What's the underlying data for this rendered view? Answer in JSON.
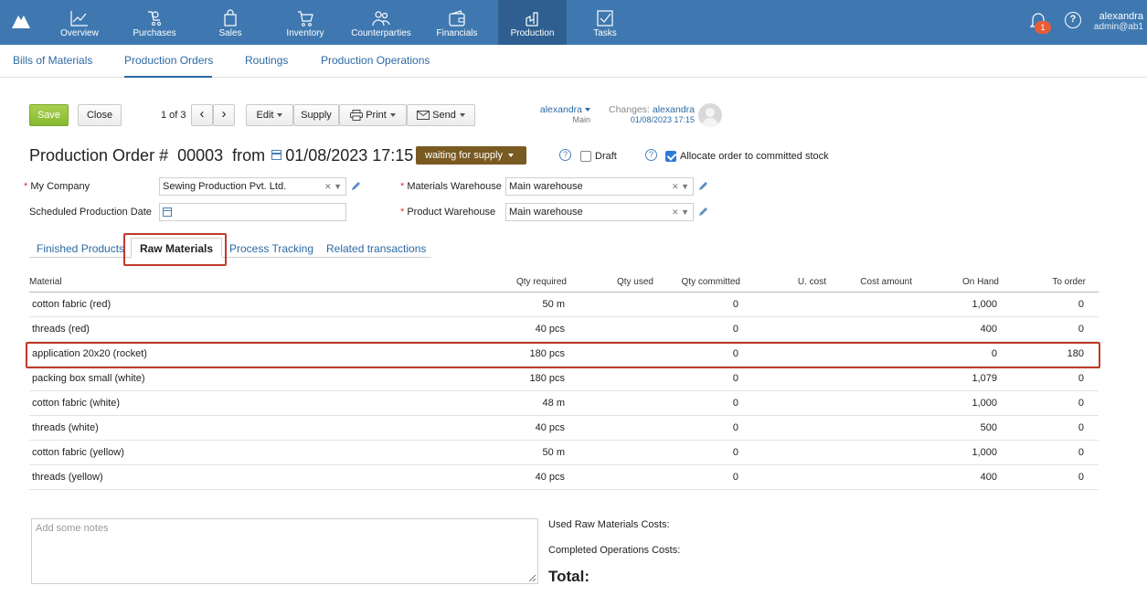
{
  "app": {
    "nav": [
      {
        "label": "Overview",
        "icon": "chart-line-icon"
      },
      {
        "label": "Purchases",
        "icon": "purchases-icon"
      },
      {
        "label": "Sales",
        "icon": "shopping-bag-icon"
      },
      {
        "label": "Inventory",
        "icon": "cart-icon"
      },
      {
        "label": "Counterparties",
        "icon": "people-icon"
      },
      {
        "label": "Financials",
        "icon": "wallet-icon"
      },
      {
        "label": "Production",
        "icon": "factory-icon"
      },
      {
        "label": "Tasks",
        "icon": "checkbox-icon"
      }
    ],
    "notifications_count": "1",
    "help": "?",
    "user": {
      "name": "alexandra",
      "email": "admin@ab1"
    }
  },
  "subnav": [
    "Bills of Materials",
    "Production Orders",
    "Routings",
    "Production Operations"
  ],
  "toolbar": {
    "save": "Save",
    "close": "Close",
    "pager": "1 of 3",
    "prev": "‹",
    "next": "›",
    "edit": "Edit",
    "supply": "Supply",
    "print": "Print",
    "send": "Send",
    "owner_name": "alexandra",
    "owner_role": "Main",
    "changes_label": "Changes:",
    "changes_user": "alexandra",
    "changes_date": "01/08/2023 17:15"
  },
  "header": {
    "title_prefix": "Production Order #",
    "number": "00003",
    "from": "from",
    "date": "01/08/2023 17:15",
    "status": "waiting for supply",
    "draft_label": "Draft",
    "allocate_label": "Allocate order to committed stock"
  },
  "form": {
    "my_company_label": "My Company",
    "my_company_value": "Sewing Production Pvt. Ltd.",
    "sched_date_label": "Scheduled Production Date",
    "sched_date_value": "",
    "materials_wh_label": "Materials Warehouse",
    "materials_wh_value": "Main warehouse",
    "product_wh_label": "Product Warehouse",
    "product_wh_value": "Main warehouse"
  },
  "tabs": [
    "Finished Products",
    "Raw Materials",
    "Process Tracking",
    "Related transactions"
  ],
  "table": {
    "columns": [
      "Material",
      "Qty required",
      "Qty used",
      "Qty committed",
      "U. cost",
      "Cost amount",
      "On Hand",
      "To order"
    ],
    "rows": [
      {
        "material": "cotton fabric (red)",
        "qty_required": "50 m",
        "qty_used": "",
        "qty_committed": "0",
        "u_cost": "",
        "cost_amount": "",
        "on_hand": "1,000",
        "to_order": "0"
      },
      {
        "material": "threads (red)",
        "qty_required": "40 pcs",
        "qty_used": "",
        "qty_committed": "0",
        "u_cost": "",
        "cost_amount": "",
        "on_hand": "400",
        "to_order": "0"
      },
      {
        "material": "application 20x20 (rocket)",
        "qty_required": "180 pcs",
        "qty_used": "",
        "qty_committed": "0",
        "u_cost": "",
        "cost_amount": "",
        "on_hand": "0",
        "to_order": "180"
      },
      {
        "material": "packing box small (white)",
        "qty_required": "180 pcs",
        "qty_used": "",
        "qty_committed": "0",
        "u_cost": "",
        "cost_amount": "",
        "on_hand": "1,079",
        "to_order": "0"
      },
      {
        "material": "cotton fabric (white)",
        "qty_required": "48 m",
        "qty_used": "",
        "qty_committed": "0",
        "u_cost": "",
        "cost_amount": "",
        "on_hand": "1,000",
        "to_order": "0"
      },
      {
        "material": "threads (white)",
        "qty_required": "40 pcs",
        "qty_used": "",
        "qty_committed": "0",
        "u_cost": "",
        "cost_amount": "",
        "on_hand": "500",
        "to_order": "0"
      },
      {
        "material": "cotton fabric (yellow)",
        "qty_required": "50 m",
        "qty_used": "",
        "qty_committed": "0",
        "u_cost": "",
        "cost_amount": "",
        "on_hand": "1,000",
        "to_order": "0"
      },
      {
        "material": "threads (yellow)",
        "qty_required": "40 pcs",
        "qty_used": "",
        "qty_committed": "0",
        "u_cost": "",
        "cost_amount": "",
        "on_hand": "400",
        "to_order": "0"
      }
    ]
  },
  "bottom": {
    "notes_placeholder": "Add some notes",
    "used_raw_costs": "Used Raw Materials Costs:",
    "completed_ops_costs": "Completed Operations Costs:",
    "total": "Total:"
  },
  "colors": {
    "nav_bg": "#3f78b0",
    "nav_active": "#2e5f90",
    "save_green": "#88b932",
    "status_brown": "#7a5a23",
    "highlight_red": "#c0392b",
    "link_blue": "#2d6aa3"
  }
}
